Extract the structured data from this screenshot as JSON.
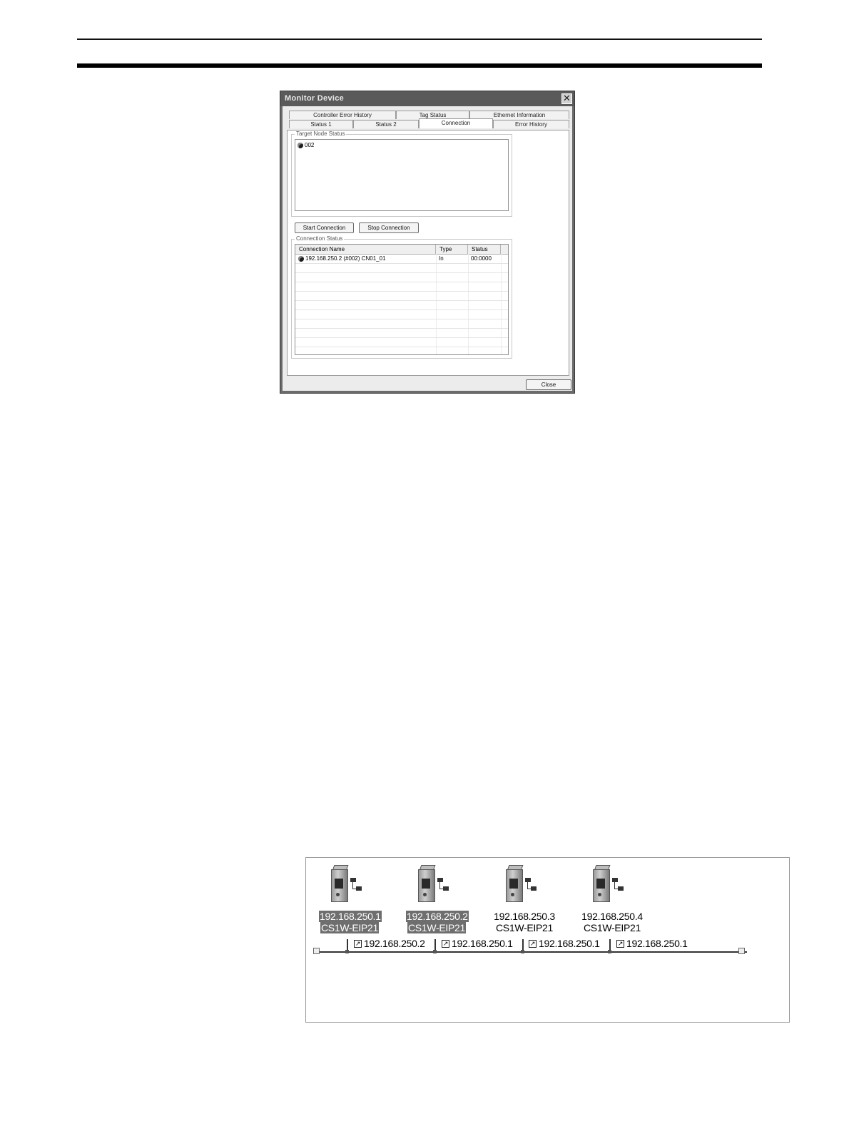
{
  "dialog": {
    "title": "Monitor Device",
    "close_glyph": "✕",
    "tabs_row1": [
      "Controller Error History",
      "Tag Status",
      "Ethernet Information"
    ],
    "tabs_row2": [
      "Status 1",
      "Status 2",
      "Connection",
      "Error History"
    ],
    "active_tab": "Connection",
    "target_node_status": {
      "label": "Target Node Status",
      "nodes": [
        "002"
      ]
    },
    "buttons": {
      "start": "Start Connection",
      "stop": "Stop Connection",
      "close": "Close"
    },
    "connection_status": {
      "label": "Connection Status",
      "columns": [
        "Connection Name",
        "Type",
        "Status"
      ],
      "rows": [
        {
          "name": "192.168.250.2 (#002) CN01_01",
          "type": "In",
          "status": "00:0000"
        }
      ]
    }
  },
  "network": {
    "nodes": [
      {
        "ip": "192.168.250.1",
        "model": "CS1W-EIP21",
        "selected": true
      },
      {
        "ip": "192.168.250.2",
        "model": "CS1W-EIP21",
        "selected": true
      },
      {
        "ip": "192.168.250.3",
        "model": "CS1W-EIP21",
        "selected": false
      },
      {
        "ip": "192.168.250.4",
        "model": "CS1W-EIP21",
        "selected": false
      }
    ],
    "connections": [
      "192.168.250.2",
      "192.168.250.1",
      "192.168.250.1",
      "192.168.250.1"
    ],
    "connection_icon": "shortcut-arrow-icon"
  }
}
